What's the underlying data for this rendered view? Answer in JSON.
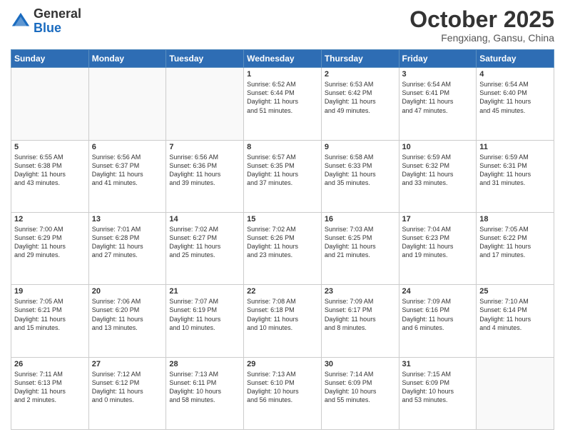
{
  "logo": {
    "general": "General",
    "blue": "Blue"
  },
  "header": {
    "month": "October 2025",
    "location": "Fengxiang, Gansu, China"
  },
  "weekdays": [
    "Sunday",
    "Monday",
    "Tuesday",
    "Wednesday",
    "Thursday",
    "Friday",
    "Saturday"
  ],
  "weeks": [
    [
      {
        "day": "",
        "info": ""
      },
      {
        "day": "",
        "info": ""
      },
      {
        "day": "",
        "info": ""
      },
      {
        "day": "1",
        "info": "Sunrise: 6:52 AM\nSunset: 6:44 PM\nDaylight: 11 hours\nand 51 minutes."
      },
      {
        "day": "2",
        "info": "Sunrise: 6:53 AM\nSunset: 6:42 PM\nDaylight: 11 hours\nand 49 minutes."
      },
      {
        "day": "3",
        "info": "Sunrise: 6:54 AM\nSunset: 6:41 PM\nDaylight: 11 hours\nand 47 minutes."
      },
      {
        "day": "4",
        "info": "Sunrise: 6:54 AM\nSunset: 6:40 PM\nDaylight: 11 hours\nand 45 minutes."
      }
    ],
    [
      {
        "day": "5",
        "info": "Sunrise: 6:55 AM\nSunset: 6:38 PM\nDaylight: 11 hours\nand 43 minutes."
      },
      {
        "day": "6",
        "info": "Sunrise: 6:56 AM\nSunset: 6:37 PM\nDaylight: 11 hours\nand 41 minutes."
      },
      {
        "day": "7",
        "info": "Sunrise: 6:56 AM\nSunset: 6:36 PM\nDaylight: 11 hours\nand 39 minutes."
      },
      {
        "day": "8",
        "info": "Sunrise: 6:57 AM\nSunset: 6:35 PM\nDaylight: 11 hours\nand 37 minutes."
      },
      {
        "day": "9",
        "info": "Sunrise: 6:58 AM\nSunset: 6:33 PM\nDaylight: 11 hours\nand 35 minutes."
      },
      {
        "day": "10",
        "info": "Sunrise: 6:59 AM\nSunset: 6:32 PM\nDaylight: 11 hours\nand 33 minutes."
      },
      {
        "day": "11",
        "info": "Sunrise: 6:59 AM\nSunset: 6:31 PM\nDaylight: 11 hours\nand 31 minutes."
      }
    ],
    [
      {
        "day": "12",
        "info": "Sunrise: 7:00 AM\nSunset: 6:29 PM\nDaylight: 11 hours\nand 29 minutes."
      },
      {
        "day": "13",
        "info": "Sunrise: 7:01 AM\nSunset: 6:28 PM\nDaylight: 11 hours\nand 27 minutes."
      },
      {
        "day": "14",
        "info": "Sunrise: 7:02 AM\nSunset: 6:27 PM\nDaylight: 11 hours\nand 25 minutes."
      },
      {
        "day": "15",
        "info": "Sunrise: 7:02 AM\nSunset: 6:26 PM\nDaylight: 11 hours\nand 23 minutes."
      },
      {
        "day": "16",
        "info": "Sunrise: 7:03 AM\nSunset: 6:25 PM\nDaylight: 11 hours\nand 21 minutes."
      },
      {
        "day": "17",
        "info": "Sunrise: 7:04 AM\nSunset: 6:23 PM\nDaylight: 11 hours\nand 19 minutes."
      },
      {
        "day": "18",
        "info": "Sunrise: 7:05 AM\nSunset: 6:22 PM\nDaylight: 11 hours\nand 17 minutes."
      }
    ],
    [
      {
        "day": "19",
        "info": "Sunrise: 7:05 AM\nSunset: 6:21 PM\nDaylight: 11 hours\nand 15 minutes."
      },
      {
        "day": "20",
        "info": "Sunrise: 7:06 AM\nSunset: 6:20 PM\nDaylight: 11 hours\nand 13 minutes."
      },
      {
        "day": "21",
        "info": "Sunrise: 7:07 AM\nSunset: 6:19 PM\nDaylight: 11 hours\nand 10 minutes."
      },
      {
        "day": "22",
        "info": "Sunrise: 7:08 AM\nSunset: 6:18 PM\nDaylight: 11 hours\nand 10 minutes."
      },
      {
        "day": "23",
        "info": "Sunrise: 7:09 AM\nSunset: 6:17 PM\nDaylight: 11 hours\nand 8 minutes."
      },
      {
        "day": "24",
        "info": "Sunrise: 7:09 AM\nSunset: 6:16 PM\nDaylight: 11 hours\nand 6 minutes."
      },
      {
        "day": "25",
        "info": "Sunrise: 7:10 AM\nSunset: 6:14 PM\nDaylight: 11 hours\nand 4 minutes."
      }
    ],
    [
      {
        "day": "26",
        "info": "Sunrise: 7:11 AM\nSunset: 6:13 PM\nDaylight: 11 hours\nand 2 minutes."
      },
      {
        "day": "27",
        "info": "Sunrise: 7:12 AM\nSunset: 6:12 PM\nDaylight: 11 hours\nand 0 minutes."
      },
      {
        "day": "28",
        "info": "Sunrise: 7:13 AM\nSunset: 6:11 PM\nDaylight: 10 hours\nand 58 minutes."
      },
      {
        "day": "29",
        "info": "Sunrise: 7:13 AM\nSunset: 6:10 PM\nDaylight: 10 hours\nand 56 minutes."
      },
      {
        "day": "30",
        "info": "Sunrise: 7:14 AM\nSunset: 6:09 PM\nDaylight: 10 hours\nand 55 minutes."
      },
      {
        "day": "31",
        "info": "Sunrise: 7:15 AM\nSunset: 6:09 PM\nDaylight: 10 hours\nand 53 minutes."
      },
      {
        "day": "",
        "info": ""
      }
    ]
  ]
}
